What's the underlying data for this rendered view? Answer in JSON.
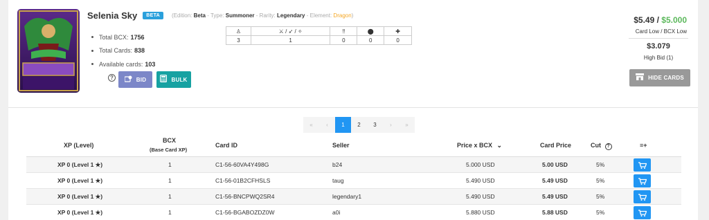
{
  "card": {
    "name": "Selenia Sky",
    "badge": "BETA",
    "meta_edition_label": "(Edition:",
    "meta_edition": "Beta",
    "meta_type_label": "- Type:",
    "meta_type": "Summoner",
    "meta_rarity_label": "- Rarity:",
    "meta_rarity": "Legendary",
    "meta_element_label": "- Element:",
    "meta_element": "Dragon",
    "meta_close": ")",
    "stats": [
      {
        "label": "Total BCX:",
        "value": "1756"
      },
      {
        "label": "Total Cards:",
        "value": "838"
      },
      {
        "label": "Available cards:",
        "value": "103"
      }
    ]
  },
  "actions": {
    "help": "?",
    "bid_label": "BID",
    "bulk_label": "BULK",
    "hide_label": "HIDE CARDS"
  },
  "summoner_stats": {
    "headers": [
      "♙",
      "⚔ / ➶ / ✧",
      "‼",
      "⬤",
      "✚"
    ],
    "values": [
      "3",
      "1",
      "0",
      "0",
      "0"
    ]
  },
  "pricing": {
    "card_low": "$5.49",
    "separator": " / ",
    "bcx_low": "$5.000",
    "low_label": "Card Low / BCX Low",
    "high_bid": "$3.079",
    "high_bid_label": "High Bid (1)"
  },
  "pagination": {
    "first": "«",
    "prev": "‹",
    "pages": [
      "1",
      "2",
      "3"
    ],
    "next": "›",
    "last": "»",
    "active": "1"
  },
  "listing": {
    "headers": {
      "xp": "XP (Level)",
      "bcx": "BCX",
      "bcx_sub": "(Base Card XP)",
      "card_id": "Card ID",
      "seller": "Seller",
      "price_bcx": "Price x BCX",
      "card_price": "Card Price",
      "cut": "Cut",
      "filter": "≡+"
    },
    "rows": [
      {
        "xp": "XP 0 (Level 1 ★)",
        "bcx": "1",
        "card_id": "C1-56-60VA4Y498G",
        "seller": "b24",
        "price_bcx": "5.000 USD",
        "card_price": "5.00 USD",
        "cut": "5%"
      },
      {
        "xp": "XP 0 (Level 1 ★)",
        "bcx": "1",
        "card_id": "C1-56-01B2CFHSLS",
        "seller": "taug",
        "price_bcx": "5.490 USD",
        "card_price": "5.49 USD",
        "cut": "5%"
      },
      {
        "xp": "XP 0 (Level 1 ★)",
        "bcx": "1",
        "card_id": "C1-56-BNCPWQ2SR4",
        "seller": "legendary1",
        "price_bcx": "5.490 USD",
        "card_price": "5.49 USD",
        "cut": "5%"
      },
      {
        "xp": "XP 0 (Level 1 ★)",
        "bcx": "1",
        "card_id": "C1-56-BGABOZDZ0W",
        "seller": "a0i",
        "price_bcx": "5.880 USD",
        "card_price": "5.88 USD",
        "cut": "5%"
      }
    ]
  },
  "colors": {
    "accent_blue": "#2196f3",
    "bid_purple": "#7c87c8",
    "bulk_teal": "#17a2a2",
    "bcx_green": "#5cb85c",
    "element_orange": "#f5a623"
  }
}
